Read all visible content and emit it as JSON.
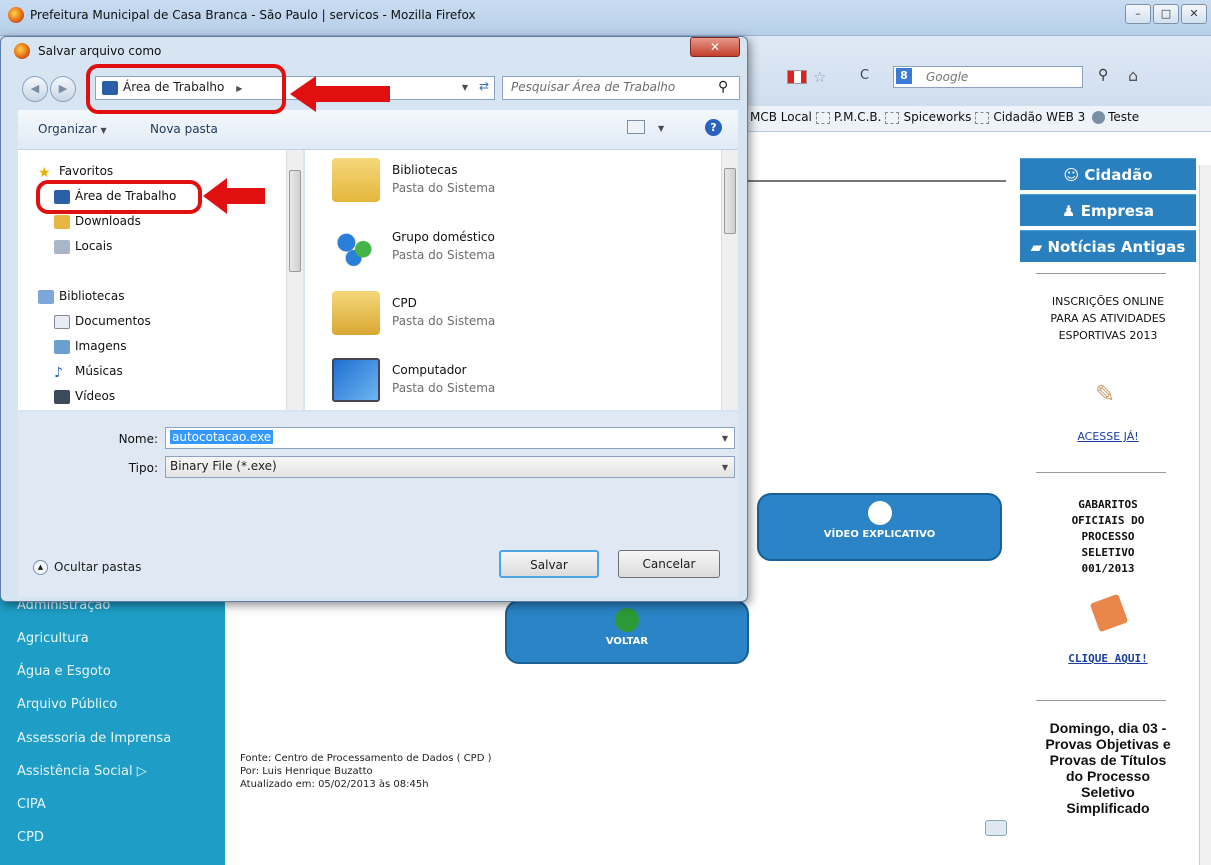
{
  "browser": {
    "window_title": "Prefeitura Municipal de Casa Branca - São Paulo | servicos - Mozilla Firefox",
    "window_controls": [
      "–",
      "□",
      "✕"
    ],
    "search_engine_placeholder": "Google",
    "bookmarks": [
      "MCB Local",
      "P.M.C.B.",
      "Spiceworks",
      "Cidadão WEB 3",
      "Teste"
    ]
  },
  "dialog": {
    "title": "Salvar arquivo como",
    "close_label": "✕",
    "address_label": "Área de Trabalho",
    "search_placeholder": "Pesquisar Área de Trabalho",
    "toolbar": {
      "organize": "Organizar",
      "new_folder": "Nova pasta",
      "help": "?"
    },
    "nav": {
      "favorites_header": "Favoritos",
      "favorites": [
        "Área de Trabalho",
        "Downloads",
        "Locais"
      ],
      "libraries_header": "Bibliotecas",
      "libraries": [
        "Documentos",
        "Imagens",
        "Músicas",
        "Vídeos"
      ]
    },
    "files": [
      {
        "name": "Bibliotecas",
        "type": "Pasta do Sistema"
      },
      {
        "name": "Grupo doméstico",
        "type": "Pasta do Sistema"
      },
      {
        "name": "CPD",
        "type": "Pasta do Sistema"
      },
      {
        "name": "Computador",
        "type": "Pasta do Sistema"
      }
    ],
    "filename_label": "Nome:",
    "filename_value": "autocotacao.exe",
    "filetype_label": "Tipo:",
    "filetype_value": "Binary File (*.exe)",
    "hide_folders": "Ocultar pastas",
    "save_label": "Salvar",
    "cancel_label": "Cancelar"
  },
  "page": {
    "side_buttons": [
      "Cidadão",
      "Empresa",
      "Notícias Antigas"
    ],
    "inscricoes": "INSCRIÇÕES ONLINE PARA AS ATIVIDADES ESPORTIVAS 2013",
    "acesse": "ACESSE JÁ!",
    "gabaritos": "GABARITOS OFICIAIS DO PROCESSO SELETIVO 001/2013",
    "clique": "CLIQUE AQUI!",
    "domingo": "Domingo, dia 03 - Provas Objetivas e Provas de Títulos do Processo Seletivo Simplificado",
    "video_button": "VÍDEO EXPLICATIVO",
    "voltar_button": "VOLTAR",
    "footnote": {
      "fonte": "Fonte: Centro de Processamento de Dados ( CPD )",
      "por": "Por: Luis Henrique Buzatto",
      "atualizado": "Atualizado em: 05/02/2013 às 08:45h"
    },
    "left_nav": [
      "Administração",
      "Agricultura",
      "Água e Esgoto",
      "Arquivo Público",
      "Assessoria de Imprensa",
      "Assistência Social ▷",
      "CIPA",
      "CPD"
    ]
  },
  "colors": {
    "accent_blue": "#2a84c6",
    "nav_cyan": "#1e9ec6",
    "annotation_red": "#e01010"
  }
}
